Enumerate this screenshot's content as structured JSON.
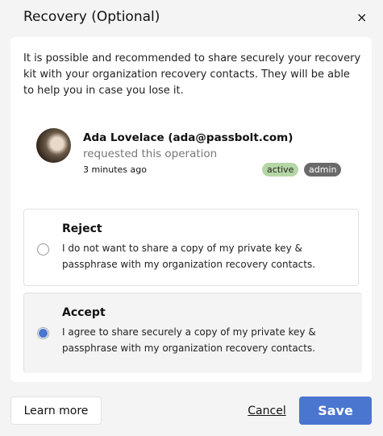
{
  "dialog": {
    "title": "Recovery (Optional)",
    "close_icon": "×"
  },
  "intro": "It is possible and recommended to share securely your recovery kit with your organization recovery contacts. They will be able to help you in case you lose it.",
  "requester": {
    "name": "Ada Lovelace (ada@passbolt.com)",
    "action": "requested this operation",
    "time": "3 minutes ago",
    "badges": [
      "active",
      "admin"
    ]
  },
  "options": [
    {
      "title": "Reject",
      "description": "I do not want to share a copy of my private key & passphrase with my organization recovery contacts.",
      "selected": false
    },
    {
      "title": "Accept",
      "description": "I agree to share securely a copy of my private key & passphrase with my organization recovery contacts.",
      "selected": true
    }
  ],
  "footer": {
    "learn_more": "Learn more",
    "cancel": "Cancel",
    "save": "Save"
  }
}
